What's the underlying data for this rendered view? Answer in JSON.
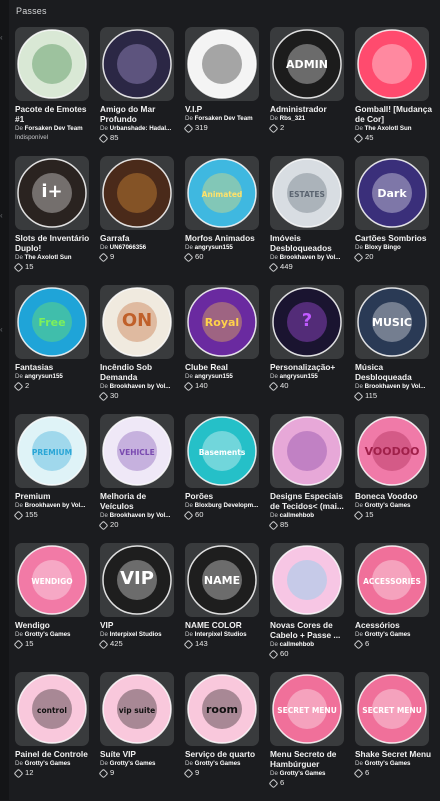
{
  "section": {
    "title": "Passes"
  },
  "creator_prefix": "De",
  "passes": [
    {
      "name": "Pacote de Emotes #1",
      "creator": "Forsaken Dev Team",
      "price": "",
      "status": "Indisponível",
      "art": "emote",
      "bg": "#d9e8d5",
      "fg": "#2f7a3a"
    },
    {
      "name": "Amigo do Mar Profundo",
      "creator": "Urbanshade: Hadal...",
      "price": "85",
      "status": "",
      "art": "deepsea",
      "bg": "#2b2745",
      "fg": "#b9a9e8"
    },
    {
      "name": "V.I.P",
      "creator": "Forsaken Dev Team",
      "price": "319",
      "status": "",
      "art": "vip",
      "bg": "#f4f4f4",
      "fg": "#111111"
    },
    {
      "name": "Administrador",
      "creator": "Rbs_321",
      "price": "2",
      "status": "",
      "art": "admin",
      "bg": "#1c1c1c",
      "fg": "#ffffff",
      "text": "ADMIN"
    },
    {
      "name": "Gomball! [Mudança de Cor]",
      "creator": "The Axolotl Sun",
      "price": "45",
      "status": "",
      "art": "gomball",
      "bg": "#ff4b6e",
      "fg": "#ffffff"
    },
    {
      "name": "Slots de Inventário Duplo!",
      "creator": "The Axolotl Sun",
      "price": "15",
      "status": "",
      "art": "slots",
      "bg": "#2a2320",
      "fg": "#ffffff",
      "text": "i+"
    },
    {
      "name": "Garrafa",
      "creator": "UN67066356",
      "price": "9",
      "status": "",
      "art": "bottle",
      "bg": "#4a2a1a",
      "fg": "#f0a040"
    },
    {
      "name": "Morfos Animados",
      "creator": "angrysun155",
      "price": "60",
      "status": "",
      "art": "morphs",
      "bg": "#3fb8e0",
      "fg": "#ffe26a",
      "text": "Animated"
    },
    {
      "name": "Imóveis Desbloqueados",
      "creator": "Brookhaven by Vol...",
      "price": "449",
      "status": "",
      "art": "estates",
      "bg": "#d8dde2",
      "fg": "#5a6470",
      "text": "ESTATES"
    },
    {
      "name": "Cartões Sombrios",
      "creator": "Bloxy Bingo",
      "price": "20",
      "status": "",
      "art": "cards",
      "bg": "#3a2f7a",
      "fg": "#ffffff",
      "text": "Dark"
    },
    {
      "name": "Fantasias",
      "creator": "angrysun155",
      "price": "2",
      "status": "",
      "art": "costumes",
      "bg": "#1fa4d8",
      "fg": "#7ef05a",
      "text": "Free"
    },
    {
      "name": "Incêndio Sob Demanda",
      "creator": "Brookhaven by Vol...",
      "price": "30",
      "status": "",
      "art": "fire",
      "bg": "#f0eadf",
      "fg": "#c0602a",
      "text": "ON"
    },
    {
      "name": "Clube Real",
      "creator": "angrysun155",
      "price": "140",
      "status": "",
      "art": "royal",
      "bg": "#6a2aa0",
      "fg": "#ffd24a",
      "text": "Royal"
    },
    {
      "name": "Personalização+",
      "creator": "angrysun155",
      "price": "40",
      "status": "",
      "art": "custom",
      "bg": "#1a1430",
      "fg": "#c05aff",
      "text": "?"
    },
    {
      "name": "Música Desbloqueada",
      "creator": "Brookhaven by Vol...",
      "price": "115",
      "status": "",
      "art": "music",
      "bg": "#2a3a55",
      "fg": "#ffffff",
      "text": "MUSIC"
    },
    {
      "name": "Premium",
      "creator": "Brookhaven by Vol...",
      "price": "155",
      "status": "",
      "art": "premium",
      "bg": "#dff3f7",
      "fg": "#2aa6d6",
      "text": "PREMIUM"
    },
    {
      "name": "Melhoria de Veículos",
      "creator": "Brookhaven by Vol...",
      "price": "20",
      "status": "",
      "art": "vehicle",
      "bg": "#efe8f7",
      "fg": "#7a4ab0",
      "text": "VEHICLE"
    },
    {
      "name": "Porões",
      "creator": "Bloxburg Developm...",
      "price": "60",
      "status": "",
      "art": "basements",
      "bg": "#25c0c8",
      "fg": "#ffffff",
      "text": "Basements"
    },
    {
      "name": "Designs Especiais de Tecidos< (mai...",
      "creator": "callmehbob",
      "price": "85",
      "status": "",
      "art": "fabric",
      "bg": "#e7a8d8",
      "fg": "#7a3aa0"
    },
    {
      "name": "Boneca Voodoo",
      "creator": "Grotty's Games",
      "price": "15",
      "status": "",
      "art": "voodoo",
      "bg": "#f07aa8",
      "fg": "#a0204a",
      "text": "VOODOO"
    },
    {
      "name": "Wendigo",
      "creator": "Grotty's Games",
      "price": "15",
      "status": "",
      "art": "wendigo",
      "bg": "#f27aa6",
      "fg": "#ffffff",
      "text": "WENDIGO"
    },
    {
      "name": "VIP",
      "creator": "Interpixel Studios",
      "price": "425",
      "status": "",
      "art": "vip2",
      "bg": "#1e1e1e",
      "fg": "#ffffff",
      "text": "VIP"
    },
    {
      "name": "NAME COLOR",
      "creator": "Interpixel Studios",
      "price": "143",
      "status": "",
      "art": "namecolor",
      "bg": "#1e1e1e",
      "fg": "#ffffff",
      "text": "NAME"
    },
    {
      "name": "Novas Cores de Cabelo + Passe ...",
      "creator": "callmehbob",
      "price": "60",
      "status": "",
      "art": "hair",
      "bg": "#f7c6e4",
      "fg": "#6ad0f0"
    },
    {
      "name": "Acessórios",
      "creator": "Grotty's Games",
      "price": "6",
      "status": "",
      "art": "accessories",
      "bg": "#f0709a",
      "fg": "#ffffff",
      "text": "ACCESSORIES"
    },
    {
      "name": "Painel de Controle",
      "creator": "Grotty's Games",
      "price": "12",
      "status": "",
      "art": "control",
      "bg": "#f9c8dc",
      "fg": "#111111",
      "text": "control"
    },
    {
      "name": "Suíte VIP",
      "creator": "Grotty's Games",
      "price": "9",
      "status": "",
      "art": "suite",
      "bg": "#f9c8dc",
      "fg": "#111111",
      "text": "vip suite"
    },
    {
      "name": "Serviço de quarto",
      "creator": "Grotty's Games",
      "price": "9",
      "status": "",
      "art": "room",
      "bg": "#f9c8dc",
      "fg": "#111111",
      "text": "room"
    },
    {
      "name": "Menu Secreto de Hambúrguer",
      "creator": "Grotty's Games",
      "price": "6",
      "status": "",
      "art": "burgers",
      "bg": "#f0709a",
      "fg": "#ffffff",
      "text": "SECRET MENU"
    },
    {
      "name": "Shake Secret Menu",
      "creator": "Grotty's Games",
      "price": "6",
      "status": "",
      "art": "shakes",
      "bg": "#f0709a",
      "fg": "#ffffff",
      "text": "SECRET MENU"
    }
  ]
}
